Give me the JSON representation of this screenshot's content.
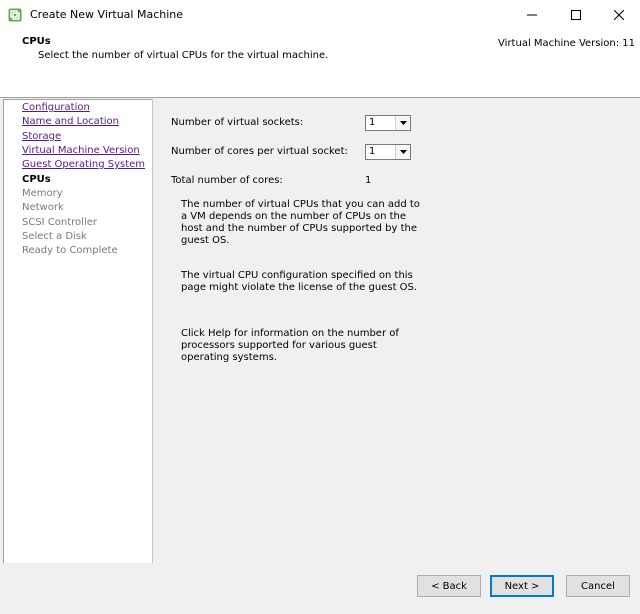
{
  "window": {
    "title": "Create New Virtual Machine",
    "controls": {
      "minimize": "minimize-icon",
      "maximize": "maximize-icon",
      "close": "close-icon"
    }
  },
  "header": {
    "title": "CPUs",
    "subtitle": "Select the number of virtual CPUs for the virtual machine.",
    "version": "Virtual Machine Version: 11"
  },
  "steps": [
    {
      "label": "Configuration",
      "state": "completed"
    },
    {
      "label": "Name and Location",
      "state": "completed"
    },
    {
      "label": "Storage",
      "state": "completed"
    },
    {
      "label": "Virtual Machine Version",
      "state": "completed"
    },
    {
      "label": "Guest Operating System",
      "state": "completed"
    },
    {
      "label": "CPUs",
      "state": "current"
    },
    {
      "label": "Memory",
      "state": "future"
    },
    {
      "label": "Network",
      "state": "future"
    },
    {
      "label": "SCSI Controller",
      "state": "future"
    },
    {
      "label": "Select a Disk",
      "state": "future"
    },
    {
      "label": "Ready to Complete",
      "state": "future"
    }
  ],
  "form": {
    "sockets_label": "Number of virtual sockets:",
    "sockets_value": "1",
    "cores_label": "Number of cores per virtual socket:",
    "cores_value": "1",
    "total_label": "Total number of cores:",
    "total_value": "1"
  },
  "info": {
    "para1": "The number of virtual CPUs that you can add to a VM depends on the number of CPUs on the host and the number of CPUs supported by the guest OS.",
    "para2": "The virtual CPU configuration specified on this page might violate the license of the guest OS.",
    "para3": "Click Help for information on the number of processors supported for various guest operating systems."
  },
  "buttons": {
    "back": "< Back",
    "next": "Next >",
    "cancel": "Cancel"
  },
  "colors": {
    "link": "#551a8b",
    "disabled": "#7a7a7a",
    "accent": "#0078d7"
  }
}
